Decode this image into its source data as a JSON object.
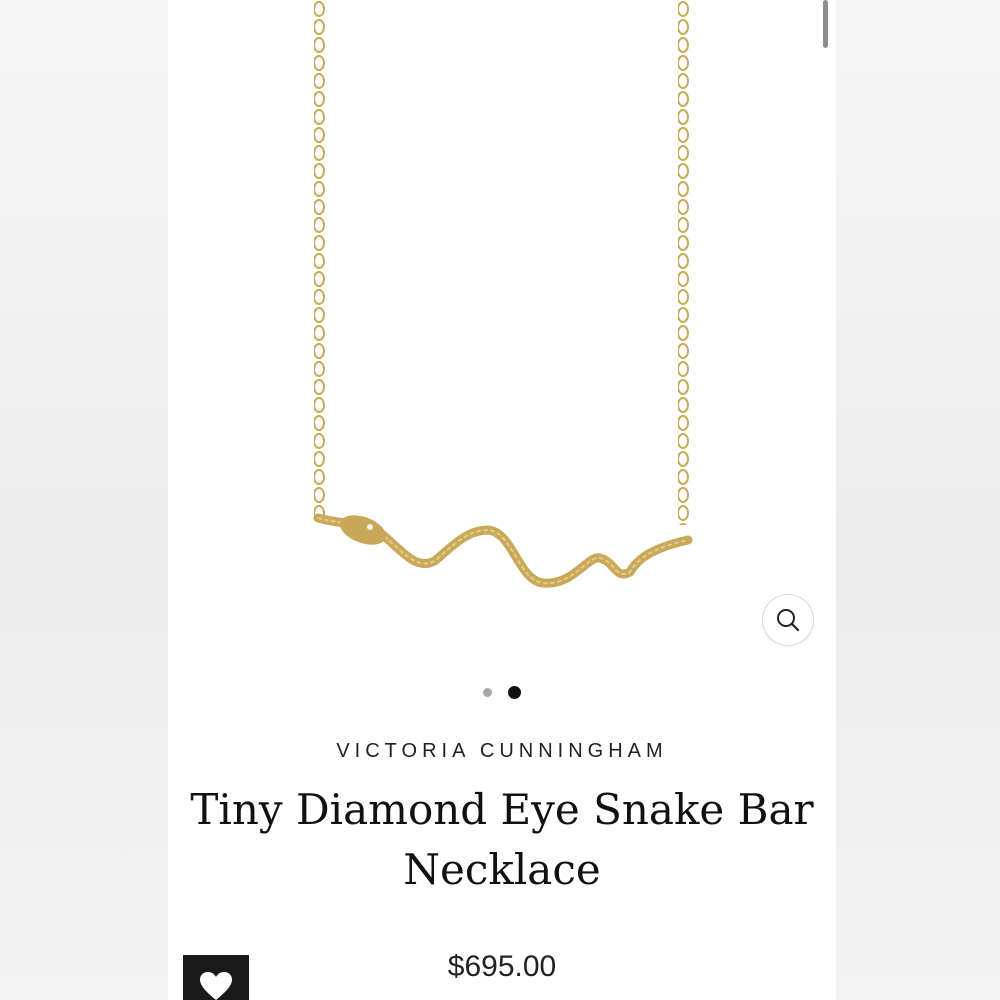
{
  "product": {
    "brand": "VICTORIA CUNNINGHAM",
    "title": "Tiny Diamond Eye Snake Bar Necklace",
    "price": "$695.00"
  },
  "gallery": {
    "slide_count": 2,
    "active_slide": 2
  },
  "icons": {
    "zoom": "search-icon",
    "favorite": "heart-icon"
  },
  "colors": {
    "gold": "#c9a85a",
    "dark": "#1a1a1a",
    "page_background": "#ffffff"
  }
}
